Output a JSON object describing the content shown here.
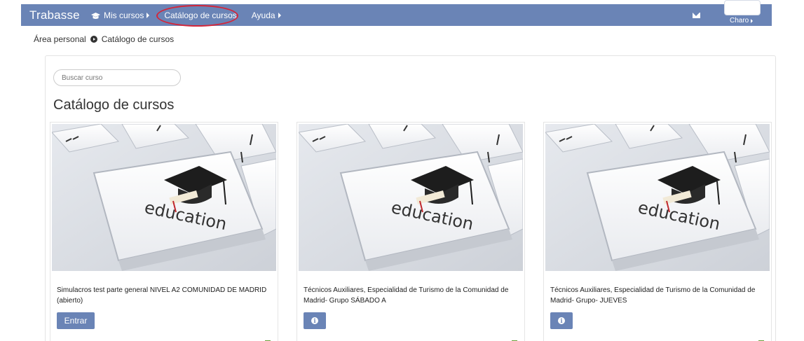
{
  "navbar": {
    "brand": "Trabasse",
    "items": [
      {
        "label": "Mis cursos",
        "icon": "graduation-cap-icon",
        "has_caret": true
      },
      {
        "label": "Catálogo de cursos",
        "highlighted": true
      },
      {
        "label": "Ayuda",
        "has_caret": true
      }
    ],
    "messages_icon": "envelope-icon",
    "user_name": "Charo"
  },
  "breadcrumb": {
    "items": [
      "Área personal",
      "Catálogo de cursos"
    ],
    "separator_icon": "chevron-circle-right-icon"
  },
  "search": {
    "placeholder": "Buscar curso"
  },
  "page_title": "Catálogo de cursos",
  "courses": [
    {
      "image": "education-keyboard-image",
      "title": "Simulacros test parte general NIVEL A2 COMUNIDAD DE MADRID (abierto)",
      "action": "Entrar",
      "action_type": "text-button",
      "footer_icon": "basket-icon"
    },
    {
      "image": "education-keyboard-image",
      "title": "Técnicos Auxiliares, Especialidad de Turismo de la Comunidad de Madrid- Grupo SÁBADO A",
      "action": "i",
      "action_type": "info-button",
      "footer_icon": "basket-icon"
    },
    {
      "image": "education-keyboard-image",
      "title": "Técnicos Auxiliares, Especialidad de Turismo de la Comunidad de Madrid- Grupo- JUEVES",
      "action": "i",
      "action_type": "info-button",
      "footer_icon": "basket-icon"
    }
  ],
  "colors": {
    "navbar": "#6a84b6",
    "button": "#6a84b6",
    "highlight_ring": "#d3263a",
    "basket_icon": "#6a9f3a"
  }
}
